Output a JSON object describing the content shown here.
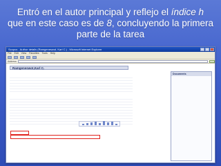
{
  "slide": {
    "title_part1": "Entró en el autor principal y reflejo el ",
    "title_index": "índice h",
    "title_part2": "que en este caso es de ",
    "title_value": "8",
    "title_part3": ", concluyendo la primera parte de la tarea"
  },
  "browser": {
    "window_title": "Scopus - Author details (Ramgeneswot, Karl C.) - Microsoft Internet Explorer",
    "menu": [
      "File",
      "Edit",
      "View",
      "Favorites",
      "Tools",
      "Help"
    ],
    "address_label": "Address"
  },
  "profile": {
    "header": "Ramgeneswot,Karl C."
  },
  "sidebar": {
    "title": "Documents"
  }
}
